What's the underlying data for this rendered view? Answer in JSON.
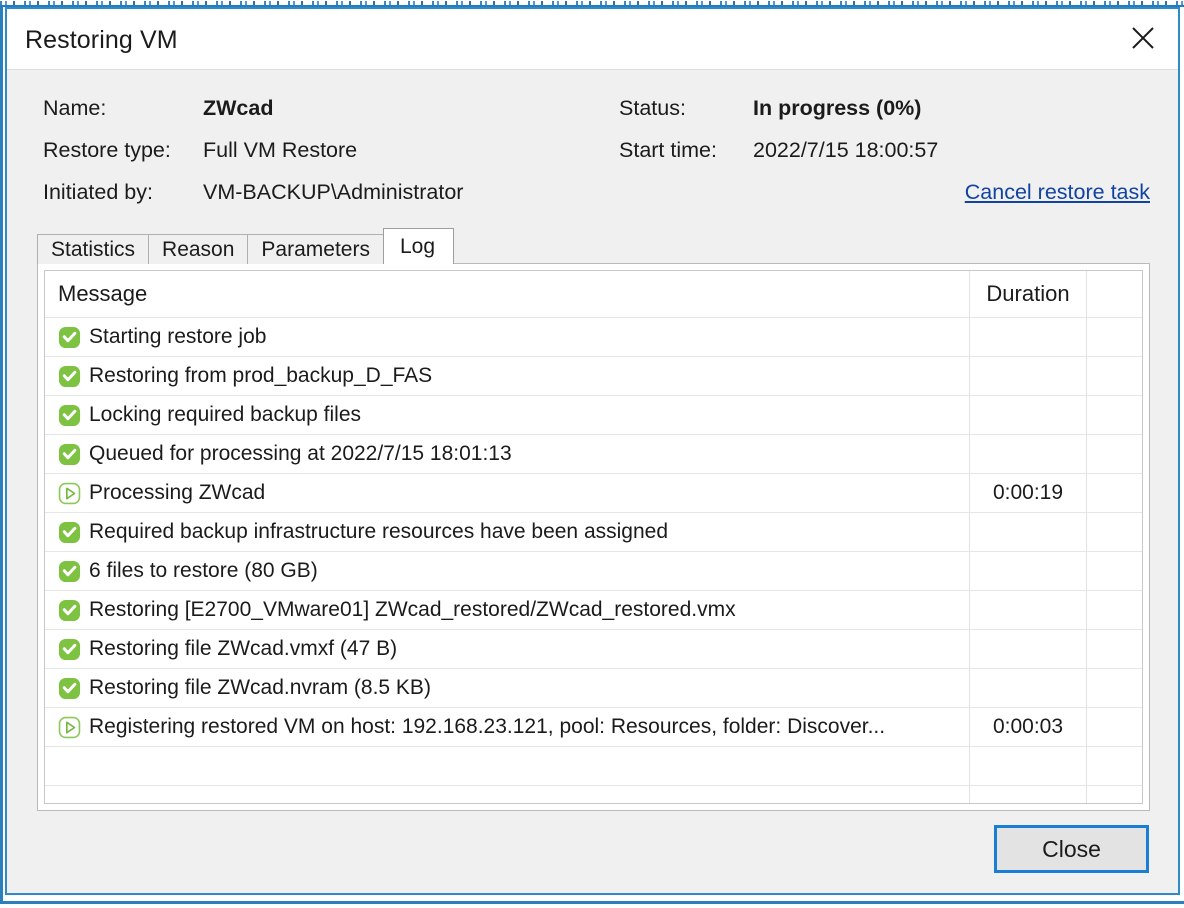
{
  "window": {
    "title": "Restoring VM",
    "close_icon": "close-x-icon"
  },
  "info": {
    "name_label": "Name:",
    "name_value": "ZWcad",
    "restore_type_label": "Restore type:",
    "restore_type_value": "Full VM Restore",
    "initiated_by_label": "Initiated by:",
    "initiated_by_value": "VM-BACKUP\\Administrator",
    "status_label": "Status:",
    "status_value": "In progress (0%)",
    "start_time_label": "Start time:",
    "start_time_value": "2022/7/15 18:00:57",
    "cancel_link": "Cancel restore task"
  },
  "tabs": [
    {
      "label": "Statistics",
      "active": false
    },
    {
      "label": "Reason",
      "active": false
    },
    {
      "label": "Parameters",
      "active": false
    },
    {
      "label": "Log",
      "active": true
    }
  ],
  "log": {
    "columns": [
      "Message",
      "Duration",
      ""
    ],
    "rows": [
      {
        "icon": "success",
        "message": "Starting restore job",
        "duration": ""
      },
      {
        "icon": "success",
        "message": "Restoring from prod_backup_D_FAS",
        "duration": ""
      },
      {
        "icon": "success",
        "message": "Locking required backup files",
        "duration": ""
      },
      {
        "icon": "success",
        "message": "Queued for processing at 2022/7/15 18:01:13",
        "duration": ""
      },
      {
        "icon": "in-progress",
        "message": "Processing ZWcad",
        "duration": "0:00:19"
      },
      {
        "icon": "success",
        "message": "Required backup infrastructure resources have been assigned",
        "duration": ""
      },
      {
        "icon": "success",
        "message": "6 files to restore (80 GB)",
        "duration": ""
      },
      {
        "icon": "success",
        "message": "Restoring [E2700_VMware01] ZWcad_restored/ZWcad_restored.vmx",
        "duration": ""
      },
      {
        "icon": "success",
        "message": "Restoring file ZWcad.vmxf (47 B)",
        "duration": ""
      },
      {
        "icon": "success",
        "message": "Restoring file ZWcad.nvram (8.5 KB)",
        "duration": ""
      },
      {
        "icon": "in-progress",
        "message": "Registering restored VM on host: 192.168.23.121, pool: Resources, folder: Discover...",
        "duration": "0:00:03"
      }
    ],
    "blank_rows": 2
  },
  "footer": {
    "close_label": "Close"
  },
  "colors": {
    "accent_border": "#2e8bc8",
    "link": "#1143a3",
    "success_green": "#77bc3f",
    "in_progress_green": "#7cbf45",
    "button_focus_blue": "#1a7fd4",
    "panel_bg": "#f0f0f0",
    "grid_bg": "#ffffff"
  }
}
